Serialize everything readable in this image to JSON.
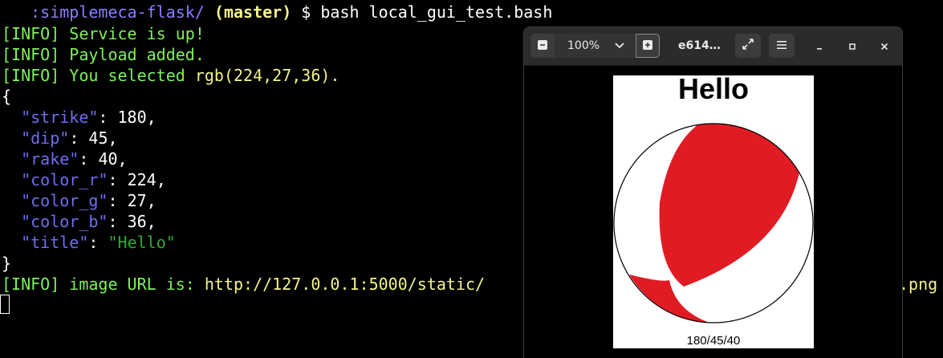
{
  "terminal": {
    "prompt": {
      "hidden_prefix": "   ",
      "path": ":simplemeca-flask/",
      "branch": "(master)",
      "symbol": "$",
      "command": "bash local_gui_test.bash"
    },
    "info_lines": [
      "[INFO] Service is up!",
      "[INFO] Payload added.",
      "[INFO] You selected "
    ],
    "selected_rgb": "rgb(224,27,36).",
    "json": {
      "open_brace": "{",
      "close_brace": "}",
      "fields": [
        {
          "key": "\"strike\"",
          "value": "180",
          "sep": ": ",
          "tail": ","
        },
        {
          "key": "\"dip\"",
          "value": "45",
          "sep": ": ",
          "tail": ","
        },
        {
          "key": "\"rake\"",
          "value": "40",
          "sep": ": ",
          "tail": ","
        },
        {
          "key": "\"color_r\"",
          "value": "224",
          "sep": ": ",
          "tail": ","
        },
        {
          "key": "\"color_g\"",
          "value": "27",
          "sep": ": ",
          "tail": ","
        },
        {
          "key": "\"color_b\"",
          "value": "36",
          "sep": ": ",
          "tail": ","
        },
        {
          "key": "\"title\"",
          "value": "\"Hello\"",
          "sep": ": ",
          "tail": ""
        }
      ]
    },
    "url_line": {
      "label": "[INFO] image URL is: ",
      "url_start": "http://127.0.0.1:5000/static/",
      "url_end": ".png"
    }
  },
  "viewer": {
    "zoom_level": "100%",
    "title": "e614…",
    "icons": {
      "zoom_out": "zoom-out-icon",
      "zoom_in": "zoom-in-icon",
      "dropdown": "chevron-down-icon",
      "fullscreen": "fullscreen-icon",
      "menu": "hamburger-menu-icon",
      "minimize": "minimize-icon",
      "maximize": "maximize-icon",
      "close": "close-icon"
    },
    "image": {
      "title": "Hello",
      "caption": "180/45/40",
      "fill_color": "#e01b24"
    }
  },
  "colors": {
    "info": "#7ef05a",
    "key": "#6e6ef0",
    "string_value": "#2ea832",
    "url": "#f4f48a",
    "prompt_path": "#8a7dff"
  }
}
